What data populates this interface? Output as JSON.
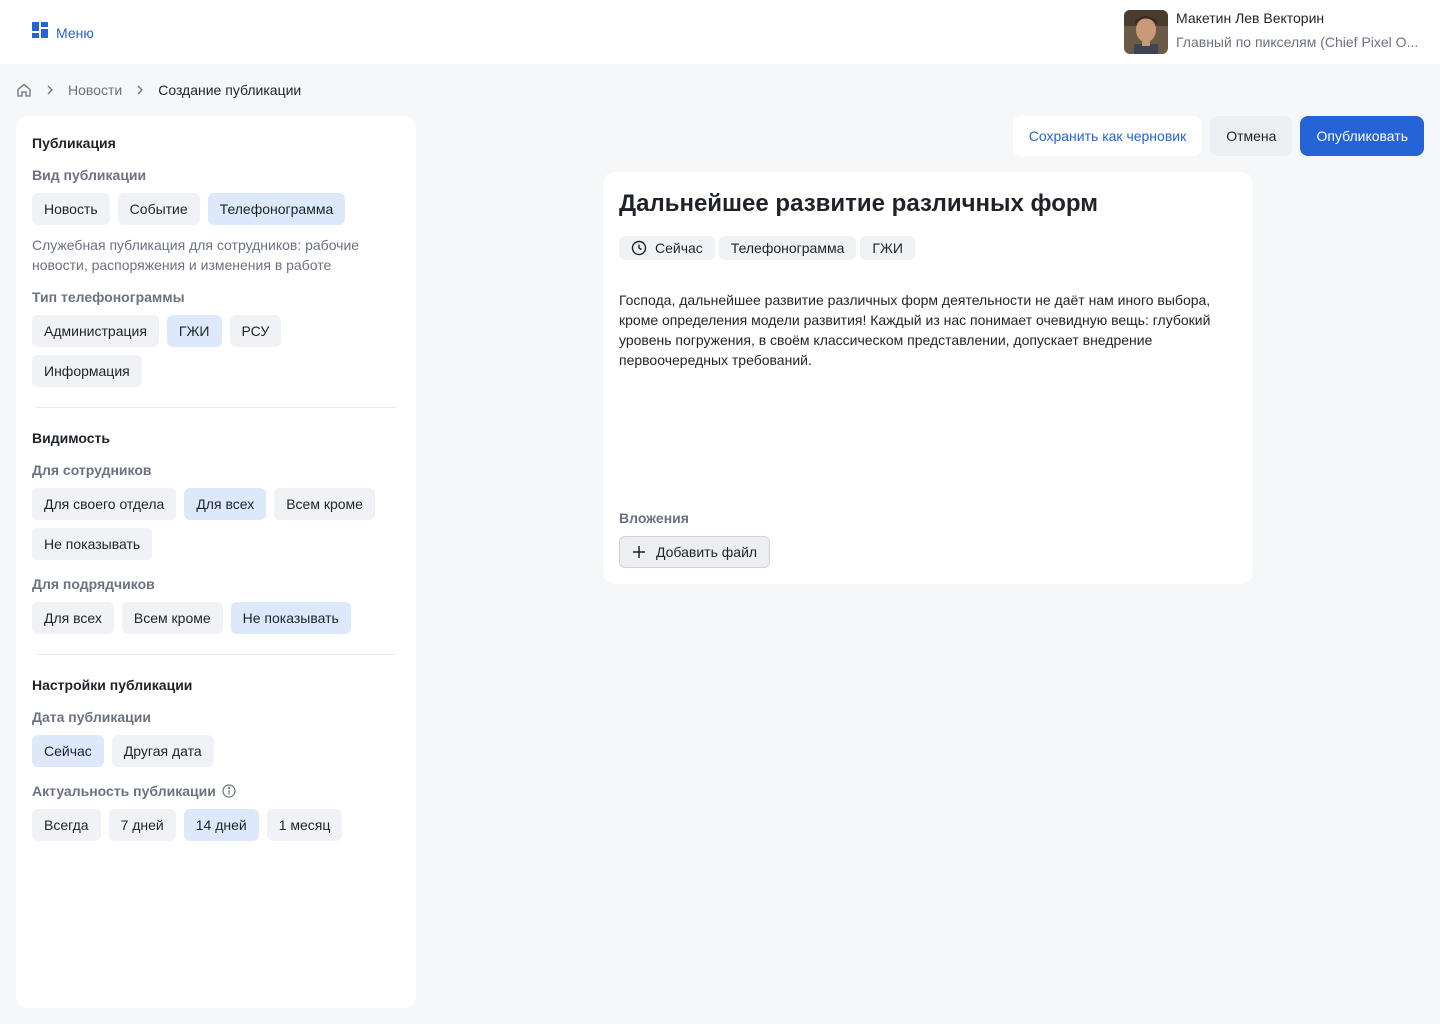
{
  "header": {
    "menu_label": "Меню",
    "user_name": "Макетин Лев Векторин",
    "user_role": "Главный по пикселям (Chief Pixel O..."
  },
  "breadcrumb": {
    "home_icon": "home-icon",
    "news": "Новости",
    "current": "Создание публикации"
  },
  "sidebar": {
    "publication_title": "Публикация",
    "kind_label": "Вид публикации",
    "kind_options": [
      "Новость",
      "Событие",
      "Телефонограмма"
    ],
    "kind_selected": "Телефонограмма",
    "kind_description": "Служебная публикация для сотрудников: рабочие новости, распоряжения и изменения в работе",
    "phone_type_label": "Тип телефонограммы",
    "phone_type_options": [
      "Администрация",
      "ГЖИ",
      "РСУ",
      "Информация"
    ],
    "phone_type_selected": "ГЖИ",
    "visibility_title": "Видимость",
    "employees_label": "Для сотрудников",
    "employees_options": [
      "Для своего отдела",
      "Для всех",
      "Всем кроме",
      "Не показывать"
    ],
    "employees_selected": "Для всех",
    "contractors_label": "Для подрядчиков",
    "contractors_options": [
      "Для всех",
      "Всем кроме",
      "Не показывать"
    ],
    "contractors_selected": "Не показывать",
    "settings_title": "Настройки публикации",
    "date_label": "Дата публикации",
    "date_options": [
      "Сейчас",
      "Другая дата"
    ],
    "date_selected": "Сейчас",
    "relevance_label": "Актуальность публикации",
    "relevance_options": [
      "Всегда",
      "7 дней",
      "14 дней",
      "1 месяц"
    ],
    "relevance_selected": "14 дней"
  },
  "actions": {
    "draft": "Сохранить как черновик",
    "cancel": "Отмена",
    "publish": "Опубликовать"
  },
  "preview": {
    "title": "Дальнейшее развитие различных форм",
    "tag_time": "Сейчас",
    "tag_kind": "Телефонограмма",
    "tag_type": "ГЖИ",
    "body": "Господа, дальнейшее развитие различных форм деятельности не даёт нам иного выбора, кроме определения модели развития! Каждый из нас понимает очевидную вещь: глубокий уровень погружения, в своём классическом представлении, допускает внедрение первоочередных требований.",
    "attachments_label": "Вложения",
    "add_file": "Добавить файл"
  },
  "colors": {
    "accent": "#2563d6",
    "chip_active": "#dde9fb",
    "chip": "#f0f2f5",
    "background": "#f6f7f9"
  }
}
